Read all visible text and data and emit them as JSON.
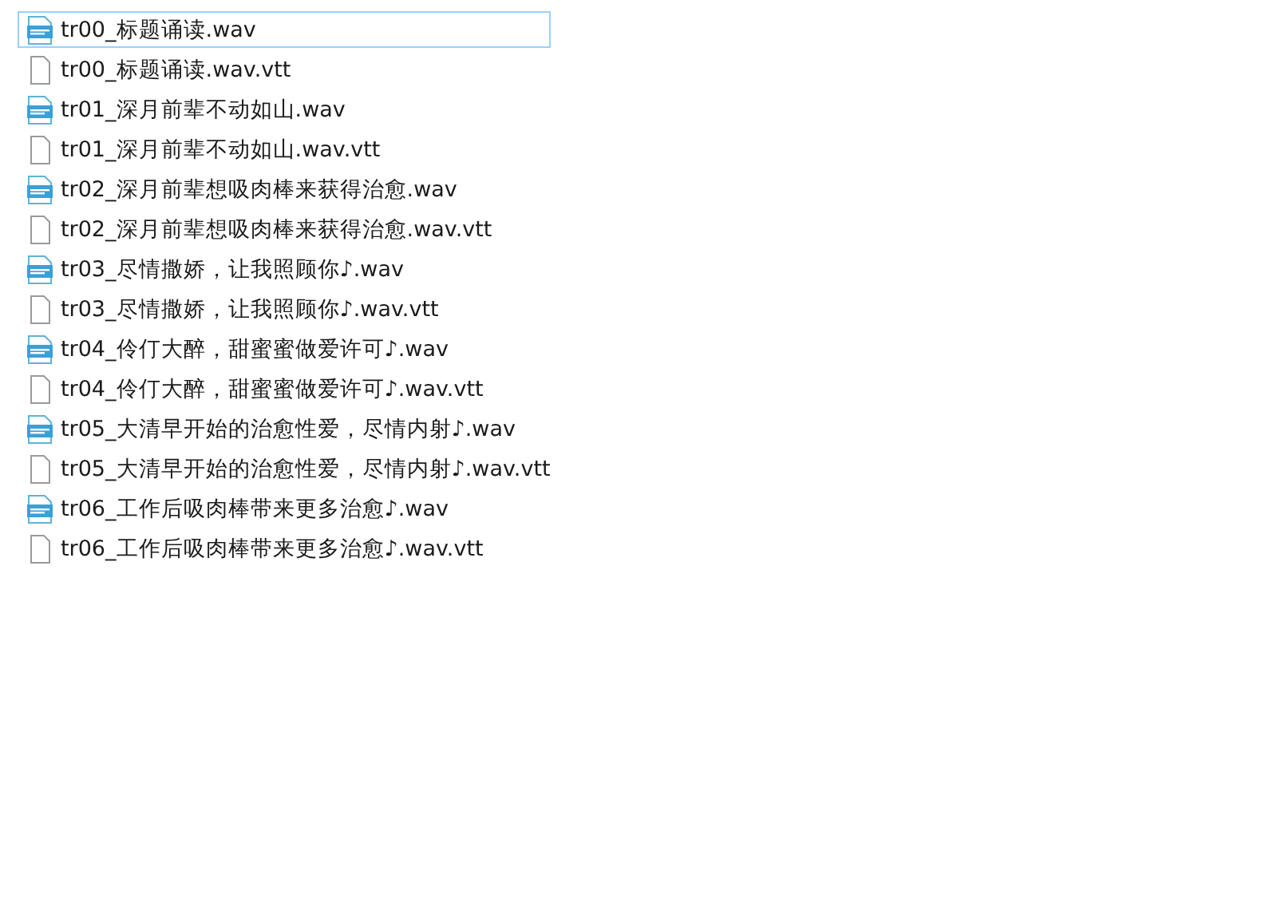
{
  "files": [
    {
      "name": "tr00_标题诵读.wav",
      "kind": "audio",
      "focused": true
    },
    {
      "name": "tr00_标题诵读.wav.vtt",
      "kind": "document",
      "focused": false
    },
    {
      "name": "tr01_深月前辈不动如山.wav",
      "kind": "audio",
      "focused": false
    },
    {
      "name": "tr01_深月前辈不动如山.wav.vtt",
      "kind": "document",
      "focused": false
    },
    {
      "name": "tr02_深月前辈想吸肉棒来获得治愈.wav",
      "kind": "audio",
      "focused": false
    },
    {
      "name": "tr02_深月前辈想吸肉棒来获得治愈.wav.vtt",
      "kind": "document",
      "focused": false
    },
    {
      "name": "tr03_尽情撒娇，让我照顾你♪.wav",
      "kind": "audio",
      "focused": false
    },
    {
      "name": "tr03_尽情撒娇，让我照顾你♪.wav.vtt",
      "kind": "document",
      "focused": false
    },
    {
      "name": "tr04_伶仃大醉，甜蜜蜜做爱许可♪.wav",
      "kind": "audio",
      "focused": false
    },
    {
      "name": "tr04_伶仃大醉，甜蜜蜜做爱许可♪.wav.vtt",
      "kind": "document",
      "focused": false
    },
    {
      "name": "tr05_大清早开始的治愈性爱，尽情内射♪.wav",
      "kind": "audio",
      "focused": false
    },
    {
      "name": "tr05_大清早开始的治愈性爱，尽情内射♪.wav.vtt",
      "kind": "document",
      "focused": false
    },
    {
      "name": "tr06_工作后吸肉棒带来更多治愈♪.wav",
      "kind": "audio",
      "focused": false
    },
    {
      "name": "tr06_工作后吸肉棒带来更多治愈♪.wav.vtt",
      "kind": "document",
      "focused": false
    }
  ]
}
